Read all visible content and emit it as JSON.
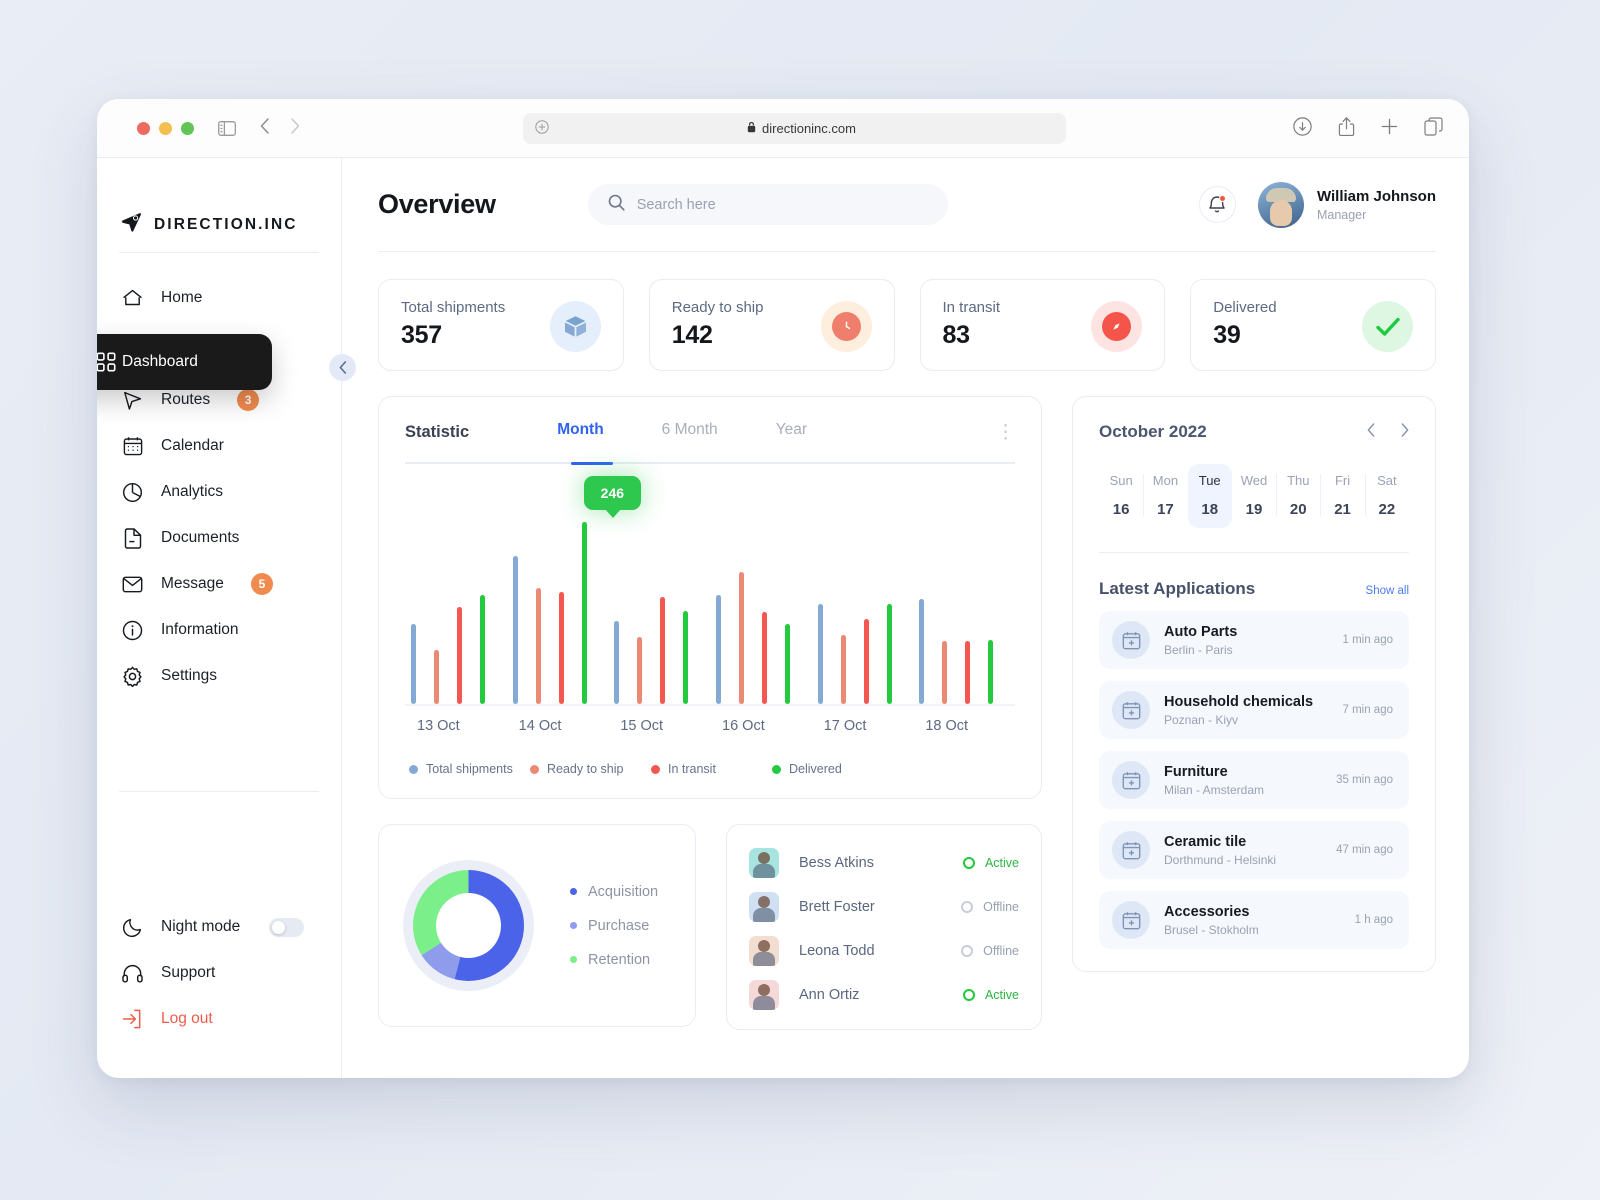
{
  "browser": {
    "url": "directioninc.com",
    "lock_icon": "lock-icon",
    "sidebar_toggle_icon": "sidebar-toggle-icon",
    "back_icon": "back-arrow-icon",
    "forward_icon": "forward-arrow-icon",
    "new_tab_plus": "+",
    "download_icon": "download-icon",
    "share_icon": "share-icon",
    "tabs_icon": "tabs-overview-icon",
    "url_plus": "+"
  },
  "sidebar": {
    "brand": "DIRECTION.INC",
    "collapse_icon": "chevron-left-icon",
    "items": [
      {
        "label": "Home",
        "icon": "home-icon",
        "badge": ""
      },
      {
        "label": "Routes",
        "icon": "cursor-arrow-icon",
        "badge": "3"
      },
      {
        "label": "Calendar",
        "icon": "calendar-icon",
        "badge": ""
      },
      {
        "label": "Analytics",
        "icon": "pie-chart-icon",
        "badge": ""
      },
      {
        "label": "Documents",
        "icon": "document-icon",
        "badge": ""
      },
      {
        "label": "Message",
        "icon": "envelope-icon",
        "badge": "5"
      },
      {
        "label": "Information",
        "icon": "info-circle-icon",
        "badge": ""
      },
      {
        "label": "Settings",
        "icon": "gear-icon",
        "badge": ""
      }
    ],
    "tooltip": {
      "label": "Dashboard",
      "icon": "grid-dashboard-icon"
    },
    "bottom": [
      {
        "label": "Night mode",
        "icon": "moon-icon",
        "toggle": "off"
      },
      {
        "label": "Support",
        "icon": "headset-icon"
      },
      {
        "label": "Log out",
        "icon": "logout-icon"
      }
    ]
  },
  "header": {
    "title": "Overview",
    "search_placeholder": "Search here",
    "search_value": "",
    "search_icon": "search-icon",
    "bell_icon": "bell-icon",
    "user_name": "William Johnson",
    "user_role": "Manager"
  },
  "kpis": [
    {
      "label": "Total shipments",
      "value": "357",
      "icon": "package-icon",
      "tone": "blue"
    },
    {
      "label": "Ready to ship",
      "value": "142",
      "icon": "clock-icon",
      "tone": "amber"
    },
    {
      "label": "In transit",
      "value": "83",
      "icon": "compass-icon",
      "tone": "red"
    },
    {
      "label": "Delivered",
      "value": "39",
      "icon": "check-icon",
      "tone": "green"
    }
  ],
  "statistic": {
    "title": "Statistic",
    "tabs": [
      {
        "label": "Month",
        "active": true
      },
      {
        "label": "6 Month",
        "active": false
      },
      {
        "label": "Year",
        "active": false
      }
    ],
    "menu_icon": "kebab-menu-icon",
    "tooltip_value": "246"
  },
  "chart_data": {
    "type": "bar",
    "title": "Statistic",
    "xlabel": "",
    "ylabel": "",
    "grid": false,
    "legend_position": "bottom",
    "categories": [
      "13 Oct",
      "14 Oct",
      "15 Oct",
      "16 Oct",
      "17 Oct",
      "18 Oct"
    ],
    "series": [
      {
        "name": "Total shipments",
        "color": "#84a9d4",
        "values": [
          108,
          201,
          113,
          148,
          136,
          142
        ]
      },
      {
        "name": "Ready to ship",
        "color": "#ea8974",
        "values": [
          73,
          157,
          91,
          179,
          93,
          86
        ]
      },
      {
        "name": "In transit",
        "color": "#f4574f",
        "values": [
          131,
          152,
          145,
          125,
          115,
          86
        ]
      },
      {
        "name": "Delivered",
        "color": "#23c93f",
        "values": [
          148,
          246,
          126,
          109,
          135,
          87
        ]
      }
    ],
    "ylim": [
      0,
      260
    ],
    "annotation": {
      "series": "Delivered",
      "category": "14 Oct",
      "value": "246"
    }
  },
  "donut": {
    "title": "",
    "chart_type": "pie",
    "segments": [
      {
        "label": "Acquisition",
        "color": "#4a63e8",
        "percent": 54
      },
      {
        "label": "Purchase",
        "color": "#8e9ceb",
        "percent": 12
      },
      {
        "label": "Retention",
        "color": "#7bf08a",
        "percent": 34
      }
    ]
  },
  "users": [
    {
      "name": "Bess Atkins",
      "status": "Active",
      "online": true,
      "avatar_tone": "#a8e4e0"
    },
    {
      "name": "Brett Foster",
      "status": "Offline",
      "online": false,
      "avatar_tone": "#cfe0f2"
    },
    {
      "name": "Leona Todd",
      "status": "Offline",
      "online": false,
      "avatar_tone": "#f2ddd0"
    },
    {
      "name": "Ann Ortiz",
      "status": "Active",
      "online": true,
      "avatar_tone": "#f5d8d8"
    }
  ],
  "calendar": {
    "month": "October 2022",
    "prev_icon": "chevron-left-icon",
    "next_icon": "chevron-right-icon",
    "days": [
      {
        "dow": "Sun",
        "num": "16",
        "selected": false
      },
      {
        "dow": "Mon",
        "num": "17",
        "selected": false
      },
      {
        "dow": "Tue",
        "num": "18",
        "selected": true
      },
      {
        "dow": "Wed",
        "num": "19",
        "selected": false
      },
      {
        "dow": "Thu",
        "num": "20",
        "selected": false
      },
      {
        "dow": "Fri",
        "num": "21",
        "selected": false
      },
      {
        "dow": "Sat",
        "num": "22",
        "selected": false
      }
    ]
  },
  "applications": {
    "title": "Latest Applications",
    "show_all": "Show all",
    "items": [
      {
        "name": "Auto Parts",
        "route": "Berlin - Paris",
        "time": "1 min ago",
        "icon": "calendar-plus-icon"
      },
      {
        "name": "Household chemicals",
        "route": "Poznan - Kiyv",
        "time": "7 min ago",
        "icon": "calendar-plus-icon"
      },
      {
        "name": "Furniture",
        "route": "Milan - Amsterdam",
        "time": "35 min ago",
        "icon": "calendar-plus-icon"
      },
      {
        "name": "Ceramic tile",
        "route": "Dorthmund - Helsinki",
        "time": "47 min ago",
        "icon": "calendar-plus-icon"
      },
      {
        "name": "Accessories",
        "route": "Brusel - Stokholm",
        "time": "1 h ago",
        "icon": "calendar-plus-icon"
      }
    ]
  },
  "colors": {
    "accent": "#2f63f0",
    "danger": "#f05a4b",
    "badge": "#f18a4f",
    "success": "#2dc84d"
  }
}
